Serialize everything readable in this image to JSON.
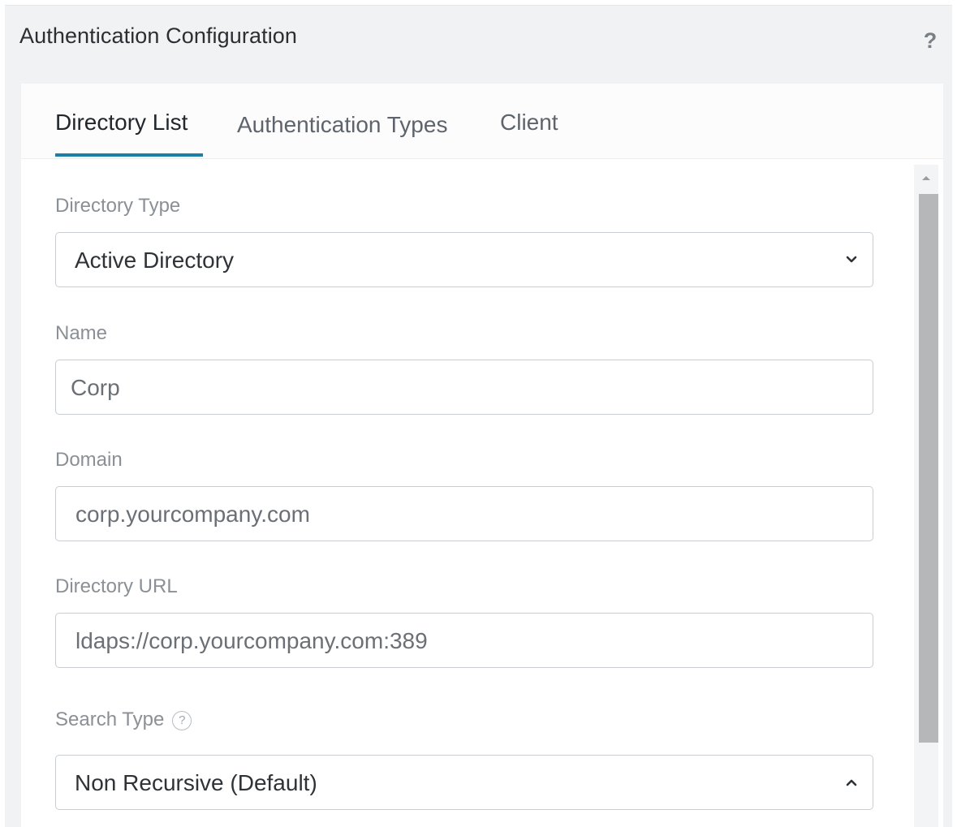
{
  "header": {
    "title": "Authentication Configuration",
    "help_label": "?"
  },
  "tabs": [
    {
      "label": "Directory List",
      "active": true
    },
    {
      "label": "Authentication Types",
      "active": false
    },
    {
      "label": "Client",
      "active": false
    }
  ],
  "form": {
    "directory_type": {
      "label": "Directory Type",
      "value": "Active Directory"
    },
    "name": {
      "label": "Name",
      "value": "Corp"
    },
    "domain": {
      "label": "Domain",
      "value": "corp.yourcompany.com"
    },
    "directory_url": {
      "label": "Directory URL",
      "value": "ldaps://corp.yourcompany.com:389"
    },
    "search_type": {
      "label": "Search Type",
      "help_label": "?",
      "value": "Non Recursive (Default)"
    }
  },
  "colors": {
    "accent": "#1c7fa6",
    "frame_background": "#f1f2f3",
    "scrollbar_thumb": "#b6b7b8"
  }
}
